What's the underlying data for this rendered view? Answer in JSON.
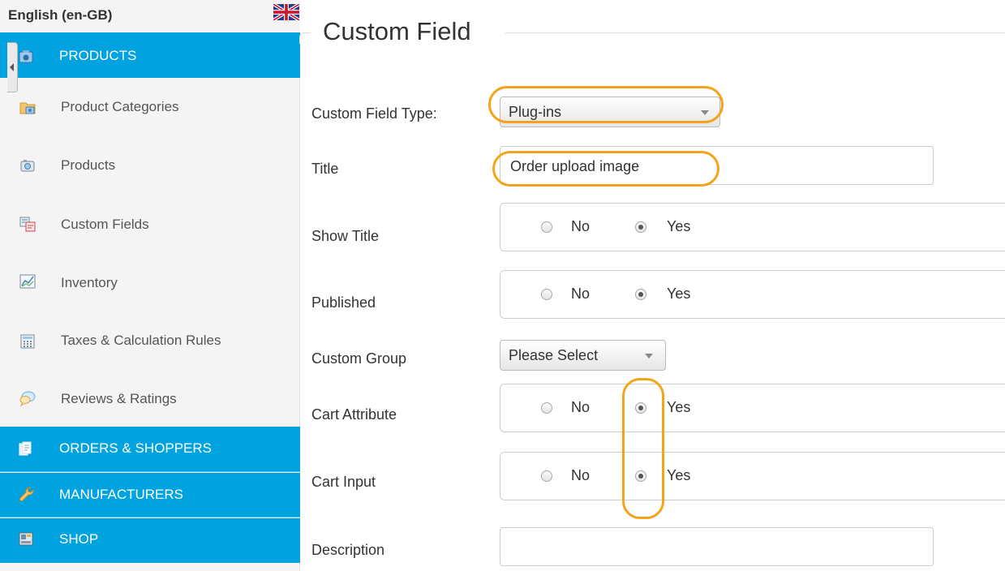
{
  "sidebar": {
    "language": "English (en-GB)",
    "flag_icon": "uk-flag-icon",
    "sections": {
      "products": "PRODUCTS",
      "orders": "ORDERS & SHOPPERS",
      "manufacturers": "MANUFACTURERS",
      "shop": "SHOP"
    },
    "items": [
      {
        "label": "Product Categories",
        "icon": "folder-camera-icon"
      },
      {
        "label": "Products",
        "icon": "camera-icon"
      },
      {
        "label": "Custom Fields",
        "icon": "custom-fields-icon"
      },
      {
        "label": "Inventory",
        "icon": "chart-icon"
      },
      {
        "label": "Taxes & Calculation Rules",
        "icon": "calculator-icon"
      },
      {
        "label": "Reviews & Ratings",
        "icon": "speech-bubble-icon"
      }
    ]
  },
  "main": {
    "title": "Custom Field",
    "fields": {
      "custom_field_type": {
        "label": "Custom Field Type:",
        "value": "Plug-ins"
      },
      "title": {
        "label": "Title",
        "value": "Order upload image"
      },
      "show_title": {
        "label": "Show Title",
        "no": "No",
        "yes": "Yes",
        "selected": "Yes"
      },
      "published": {
        "label": "Published",
        "no": "No",
        "yes": "Yes",
        "selected": "Yes"
      },
      "custom_group": {
        "label": "Custom Group",
        "value": "Please Select"
      },
      "cart_attribute": {
        "label": "Cart Attribute",
        "no": "No",
        "yes": "Yes",
        "selected": "Yes"
      },
      "cart_input": {
        "label": "Cart Input",
        "no": "No",
        "yes": "Yes",
        "selected": "Yes"
      },
      "description": {
        "label": "Description",
        "value": ""
      }
    }
  },
  "colors": {
    "accent": "#00a3e0",
    "annotation": "#f5a31a"
  }
}
